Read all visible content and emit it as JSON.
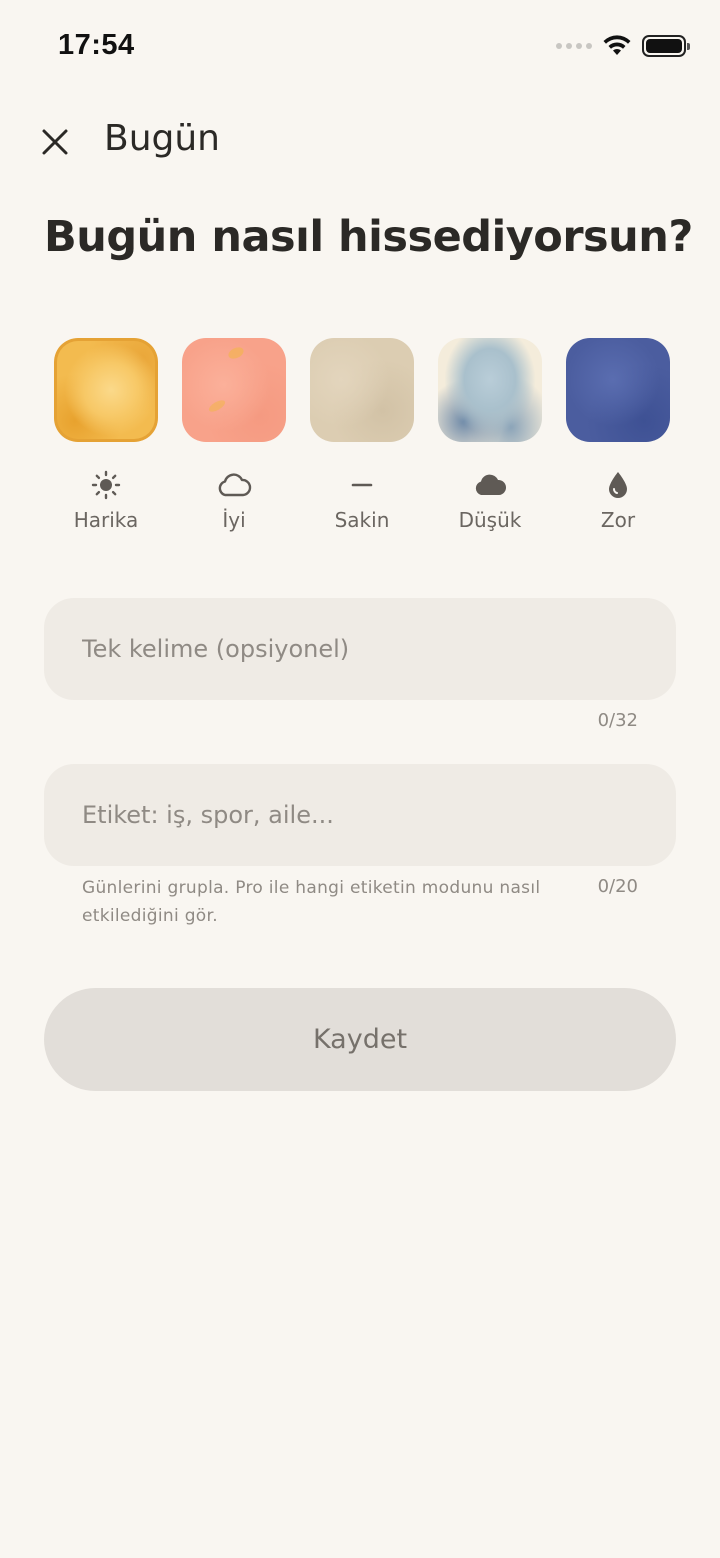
{
  "status_bar": {
    "time": "17:54",
    "icons": [
      "signal-icon",
      "wifi-icon",
      "battery-icon"
    ]
  },
  "header": {
    "close_icon": "close-icon",
    "title": "Bugün"
  },
  "question": "Bugün nasıl hissediyorsun?",
  "moods": [
    {
      "label": "Harika",
      "icon": "sun-icon",
      "color": "#f3bb4f"
    },
    {
      "label": "İyi",
      "icon": "cloud-outline-icon",
      "color": "#f8a28a"
    },
    {
      "label": "Sakin",
      "icon": "dash-icon",
      "color": "#dccdb2"
    },
    {
      "label": "Düşük",
      "icon": "cloud-filled-icon",
      "color": "#a9c0cc"
    },
    {
      "label": "Zor",
      "icon": "drop-icon",
      "color": "#4b5d9f"
    }
  ],
  "word_field": {
    "placeholder": "Tek kelime (opsiyonel)",
    "value": "",
    "counter": "0/32"
  },
  "tag_field": {
    "placeholder": "Etiket: iş, spor, aile...",
    "value": "",
    "counter": "0/20",
    "helper": "Günlerini grupla. Pro ile hangi etiketin modunu nasıl etkilediğini gör."
  },
  "save_button": {
    "label": "Kaydet"
  },
  "colors": {
    "background": "#f9f6f1",
    "input_background": "#efebe5",
    "button_disabled": "#e2ded9",
    "text_primary": "#2b2926",
    "text_muted": "#8f8a84"
  }
}
